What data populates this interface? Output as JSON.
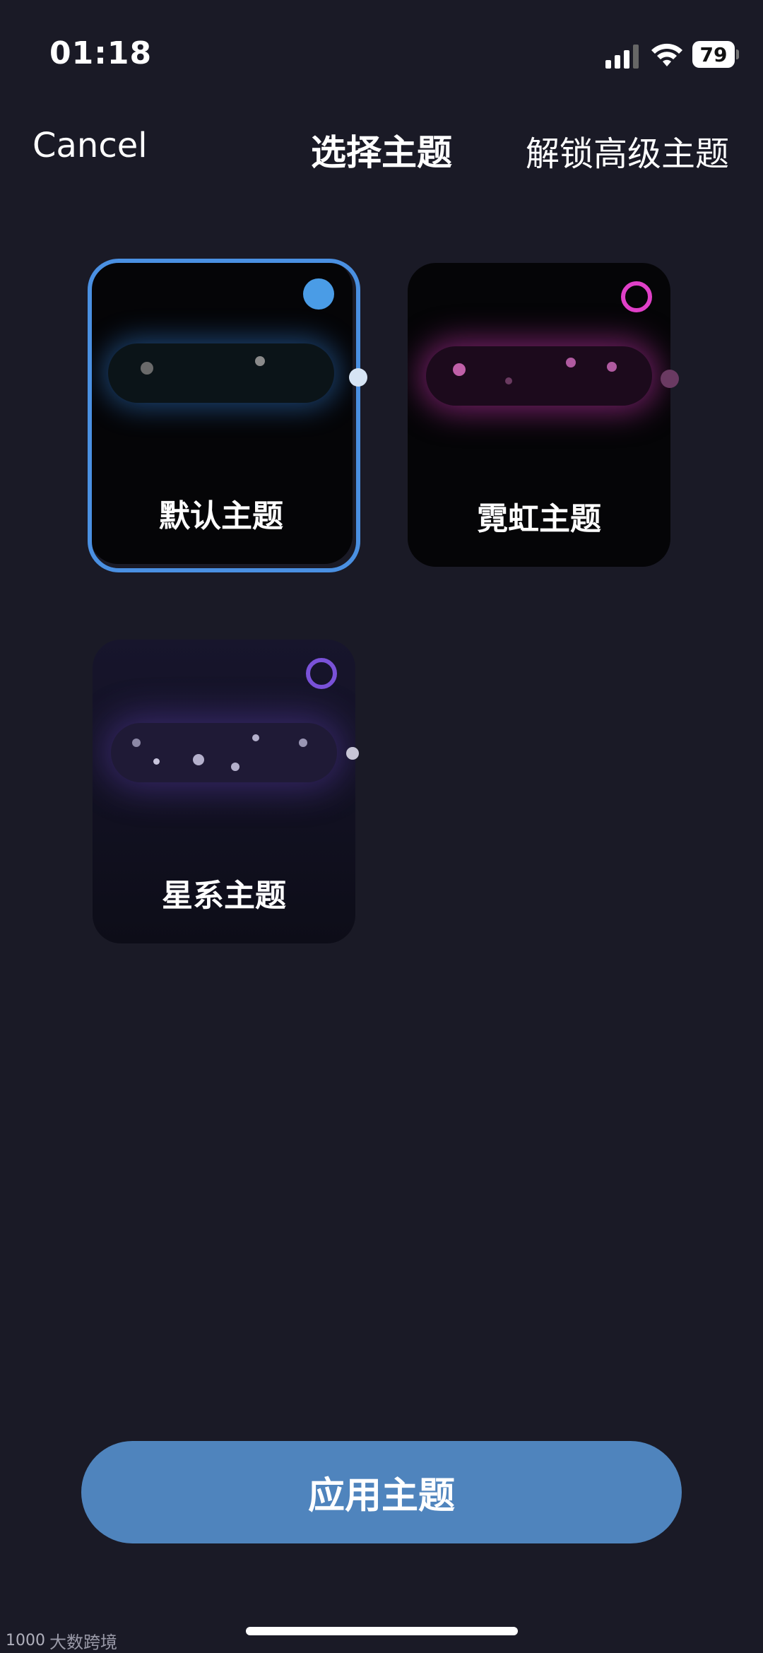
{
  "status_bar": {
    "time": "01:18",
    "battery": "79"
  },
  "nav": {
    "cancel": "Cancel",
    "title": "选择主题",
    "unlock": "解锁高级主题"
  },
  "themes": [
    {
      "label": "默认主题",
      "selected": true,
      "accent": "#4a9ce6"
    },
    {
      "label": "霓虹主题",
      "selected": false,
      "accent": "#e040c8"
    },
    {
      "label": "星系主题",
      "selected": false,
      "accent": "#7a52d8"
    }
  ],
  "apply_button": "应用主题",
  "watermark": {
    "logo": "1000",
    "text": "大数跨境"
  },
  "colors": {
    "background": "#1a1a26",
    "selection": "#4a90e2",
    "button": "#4f84bd"
  }
}
